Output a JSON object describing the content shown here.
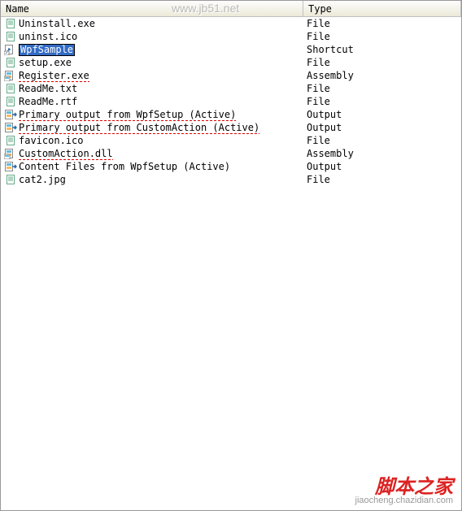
{
  "header": {
    "name": "Name",
    "type": "Type"
  },
  "rows": [
    {
      "icon": "file",
      "name": "Uninstall.exe",
      "type": "File",
      "underline": false
    },
    {
      "icon": "file",
      "name": "uninst.ico",
      "type": "File",
      "underline": false
    },
    {
      "icon": "shortcut",
      "name": "WpfSample",
      "type": "Shortcut",
      "editing": true
    },
    {
      "icon": "file",
      "name": "setup.exe",
      "type": "File",
      "underline": false
    },
    {
      "icon": "assembly",
      "name": "Register.exe",
      "type": "Assembly",
      "underline": true
    },
    {
      "icon": "file",
      "name": "ReadMe.txt",
      "type": "File",
      "underline": false
    },
    {
      "icon": "file",
      "name": "ReadMe.rtf",
      "type": "File",
      "underline": false
    },
    {
      "icon": "output",
      "name": "Primary output from WpfSetup (Active)",
      "type": "Output",
      "underline": true
    },
    {
      "icon": "output",
      "name": "Primary output from CustomAction (Active)",
      "type": "Output",
      "underline": true
    },
    {
      "icon": "file",
      "name": "favicon.ico",
      "type": "File",
      "underline": false
    },
    {
      "icon": "assembly",
      "name": "CustomAction.dll",
      "type": "Assembly",
      "underline": true
    },
    {
      "icon": "output",
      "name": "Content Files from WpfSetup (Active)",
      "type": "Output",
      "underline": false
    },
    {
      "icon": "file",
      "name": "cat2.jpg",
      "type": "File",
      "underline": false
    }
  ],
  "watermarks": {
    "top": "www.jb51.net",
    "bottom_main": "脚本之家",
    "bottom_sub": "jiaocheng.chazidian.com"
  }
}
